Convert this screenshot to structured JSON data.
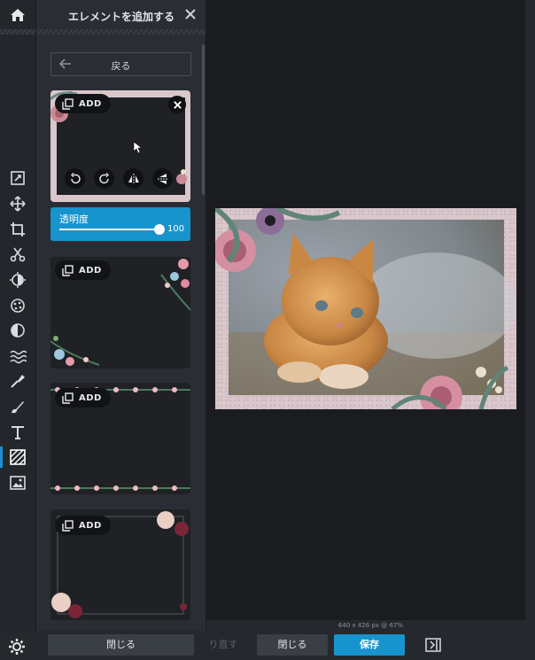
{
  "panel": {
    "title": "エレメントを追加する",
    "back_label": "戻る",
    "close_label": "閉じる"
  },
  "element_cards": [
    {
      "add_label": "ADD",
      "selected": true
    },
    {
      "add_label": "ADD"
    },
    {
      "add_label": "ADD"
    },
    {
      "add_label": "ADD"
    }
  ],
  "opacity": {
    "label": "透明度",
    "value": "100",
    "fraction": 1.0
  },
  "canvas": {
    "status": "640 x 426 px @ 67%",
    "image": "kitten-photo-with-floral-frame"
  },
  "bottom_bar": {
    "redo_label": "り直す",
    "close_label": "閉じる",
    "save_label": "保存"
  },
  "colors": {
    "accent": "#1793cd",
    "panel": "#2a2d33",
    "toolbar": "#23262b",
    "frame": "#d9c7cc"
  },
  "toolbar": {
    "items": [
      "home-icon",
      "adjust-icon",
      "move-icon",
      "crop-icon",
      "cut-icon",
      "exposure-icon",
      "filter-icon",
      "vignette-icon",
      "wave-icon",
      "brush-icon",
      "paint-icon",
      "text-icon",
      "element-icon",
      "image-icon",
      "settings-icon"
    ],
    "active": "element-icon"
  }
}
